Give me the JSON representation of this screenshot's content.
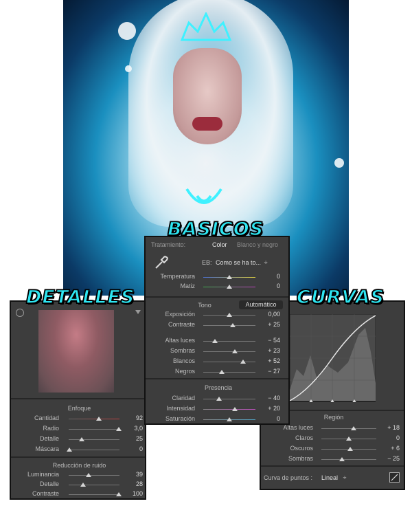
{
  "titles": {
    "basicos": "BASICOS",
    "detalles": "DETALLES",
    "curvas": "CURVAS"
  },
  "basicos": {
    "tratamiento_label": "Tratamiento:",
    "tab_color": "Color",
    "tab_bn": "Blanco y negro",
    "eb_label": "EB:",
    "eb_value": "Como se ha to...",
    "eb_arrow": "÷",
    "wb": [
      {
        "label": "Temperatura",
        "value": "0",
        "pos": 0.5
      },
      {
        "label": "Matiz",
        "value": "0",
        "pos": 0.5
      }
    ],
    "tono_title": "Tono",
    "auto_label": "Automático",
    "tono": [
      {
        "label": "Exposición",
        "value": "0,00",
        "pos": 0.5
      },
      {
        "label": "Contraste",
        "value": "+ 25",
        "pos": 0.56
      }
    ],
    "tono2": [
      {
        "label": "Altas luces",
        "value": "− 54",
        "pos": 0.23
      },
      {
        "label": "Sombras",
        "value": "+ 23",
        "pos": 0.61
      },
      {
        "label": "Blancos",
        "value": "+ 52",
        "pos": 0.76
      },
      {
        "label": "Negros",
        "value": "− 27",
        "pos": 0.36
      }
    ],
    "presencia_title": "Presencia",
    "presencia": [
      {
        "label": "Claridad",
        "value": "− 40",
        "pos": 0.3
      },
      {
        "label": "Intensidad",
        "value": "+ 20",
        "pos": 0.6
      },
      {
        "label": "Saturación",
        "value": "0",
        "pos": 0.5
      }
    ]
  },
  "detalles": {
    "enfoque_title": "Enfoque",
    "enfoque": [
      {
        "label": "Cantidad",
        "value": "92",
        "pos": 0.6
      },
      {
        "label": "Radio",
        "value": "3,0",
        "pos": 0.98
      },
      {
        "label": "Detalle",
        "value": "25",
        "pos": 0.25
      },
      {
        "label": "Máscara",
        "value": "0",
        "pos": 0.02
      }
    ],
    "ruido_title": "Reducción de ruido",
    "ruido": [
      {
        "label": "Luminancia",
        "value": "39",
        "pos": 0.39
      },
      {
        "label": "Detalle",
        "value": "28",
        "pos": 0.28
      },
      {
        "label": "Contraste",
        "value": "100",
        "pos": 0.98
      }
    ]
  },
  "curvas": {
    "region_title": "Región",
    "region": [
      {
        "label": "Altas luces",
        "value": "+ 18",
        "pos": 0.59
      },
      {
        "label": "Claros",
        "value": "0",
        "pos": 0.5
      },
      {
        "label": "Oscuros",
        "value": "+ 6",
        "pos": 0.53
      },
      {
        "label": "Sombras",
        "value": "− 25",
        "pos": 0.38
      }
    ],
    "curva_label": "Curva de puntos :",
    "curva_value": "Lineal",
    "curva_arrow": "÷"
  }
}
